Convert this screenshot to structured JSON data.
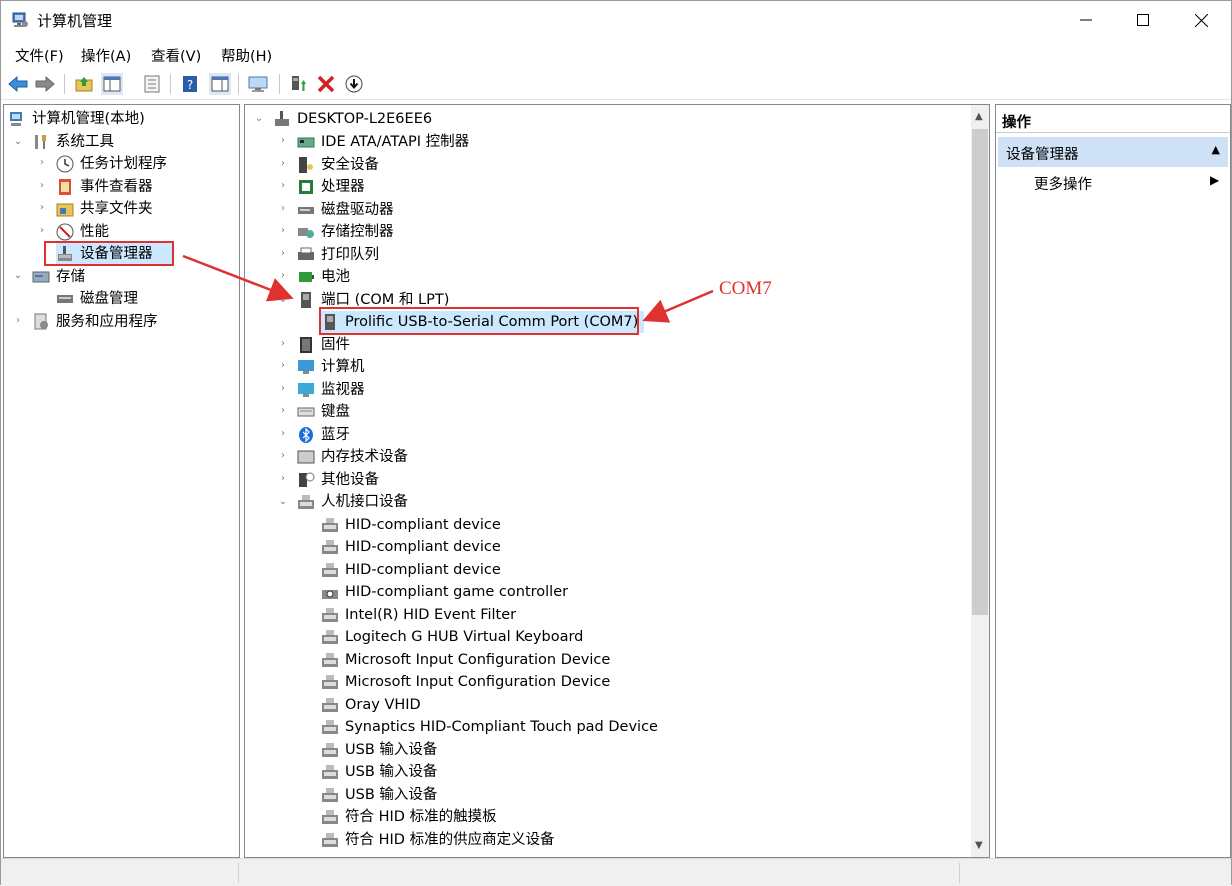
{
  "window": {
    "title": "计算机管理",
    "minimize_symbol": "—",
    "maximize_symbol": "☐",
    "close_symbol": "✕"
  },
  "menu": [
    "文件(F)",
    "操作(A)",
    "查看(V)",
    "帮助(H)"
  ],
  "toolbar": {
    "icons": [
      "back-arrow-icon",
      "forward-arrow-icon",
      "up-folder-icon",
      "show-hide-tree-icon",
      "export-list-icon",
      "help-icon",
      "show-action-pane-icon",
      "properties-icon",
      "update-driver-icon",
      "uninstall-icon",
      "scan-hardware-icon"
    ]
  },
  "left_tree": {
    "root": "计算机管理(本地)",
    "system_tools": "系统工具",
    "task_scheduler": "任务计划程序",
    "event_viewer": "事件查看器",
    "shared_folders": "共享文件夹",
    "performance": "性能",
    "device_manager": "设备管理器",
    "storage": "存储",
    "disk_management": "磁盘管理",
    "services_apps": "服务和应用程序"
  },
  "device_tree": {
    "computer": "DESKTOP-L2E6EE6",
    "categories": [
      {
        "label": "IDE ATA/ATAPI 控制器",
        "icon": "ide-controller-icon",
        "expanded": false
      },
      {
        "label": "安全设备",
        "icon": "security-device-icon",
        "expanded": false
      },
      {
        "label": "处理器",
        "icon": "processor-icon",
        "expanded": false
      },
      {
        "label": "磁盘驱动器",
        "icon": "disk-drive-icon",
        "expanded": false
      },
      {
        "label": "存储控制器",
        "icon": "storage-controller-icon",
        "expanded": false
      },
      {
        "label": "打印队列",
        "icon": "printer-icon",
        "expanded": false
      },
      {
        "label": "电池",
        "icon": "battery-icon",
        "expanded": false
      },
      {
        "label": "端口 (COM 和 LPT)",
        "icon": "port-icon",
        "expanded": true
      },
      {
        "label": "Prolific USB-to-Serial Comm Port (COM7)",
        "icon": "port-icon",
        "child": true,
        "selected": true
      },
      {
        "label": "固件",
        "icon": "firmware-icon",
        "expanded": false
      },
      {
        "label": "计算机",
        "icon": "computer-icon",
        "expanded": false
      },
      {
        "label": "监视器",
        "icon": "monitor-icon",
        "expanded": false
      },
      {
        "label": "键盘",
        "icon": "keyboard-icon",
        "expanded": false
      },
      {
        "label": "蓝牙",
        "icon": "bluetooth-icon",
        "expanded": false
      },
      {
        "label": "内存技术设备",
        "icon": "memory-device-icon",
        "expanded": false
      },
      {
        "label": "其他设备",
        "icon": "other-device-icon",
        "expanded": false
      },
      {
        "label": "人机接口设备",
        "icon": "hid-icon",
        "expanded": true
      },
      {
        "label": "HID-compliant device",
        "icon": "hid-icon",
        "child": true
      },
      {
        "label": "HID-compliant device",
        "icon": "hid-icon",
        "child": true
      },
      {
        "label": "HID-compliant device",
        "icon": "hid-icon",
        "child": true
      },
      {
        "label": "HID-compliant game controller",
        "icon": "game-controller-icon",
        "child": true
      },
      {
        "label": "Intel(R) HID Event Filter",
        "icon": "hid-icon",
        "child": true
      },
      {
        "label": "Logitech G HUB Virtual Keyboard",
        "icon": "hid-icon",
        "child": true
      },
      {
        "label": "Microsoft Input Configuration Device",
        "icon": "hid-icon",
        "child": true
      },
      {
        "label": "Microsoft Input Configuration Device",
        "icon": "hid-icon",
        "child": true
      },
      {
        "label": "Oray VHID",
        "icon": "hid-icon",
        "child": true
      },
      {
        "label": "Synaptics HID-Compliant Touch pad Device",
        "icon": "hid-icon",
        "child": true
      },
      {
        "label": "USB 输入设备",
        "icon": "hid-icon",
        "child": true
      },
      {
        "label": "USB 输入设备",
        "icon": "hid-icon",
        "child": true
      },
      {
        "label": "USB 输入设备",
        "icon": "hid-icon",
        "child": true
      },
      {
        "label": "符合 HID 标准的触摸板",
        "icon": "hid-icon",
        "child": true
      },
      {
        "label": "符合 HID 标准的供应商定义设备",
        "icon": "hid-icon",
        "child": true
      }
    ]
  },
  "actions": {
    "header": "操作",
    "section": "设备管理器",
    "more": "更多操作"
  },
  "annotation": {
    "label": "COM7",
    "color": "#e03131"
  },
  "colors": {
    "selection": "#cce8ff",
    "action_section": "#cfe1f5",
    "annotation_red": "#e03131"
  }
}
